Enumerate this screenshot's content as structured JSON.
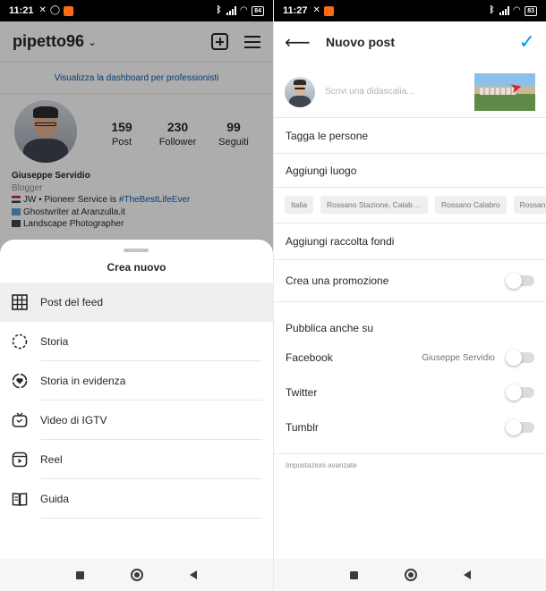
{
  "left": {
    "status": {
      "time": "11:21",
      "battery": "84"
    },
    "profile": {
      "username": "pipetto96",
      "dashboard_link": "Visualizza la dashboard per professionisti",
      "stats": [
        {
          "value": "159",
          "label": "Post"
        },
        {
          "value": "230",
          "label": "Follower"
        },
        {
          "value": "99",
          "label": "Seguiti"
        }
      ],
      "bio": {
        "name": "Giuseppe Servidio",
        "category": "Blogger",
        "line1_text": "JW • Pioneer Service is ",
        "line1_hashtag": "#TheBestLifeEver",
        "line2": "Ghostwriter at Aranzulla.it",
        "line3": "Landscape Photographer"
      }
    },
    "sheet": {
      "title": "Crea nuovo",
      "items": [
        {
          "label": "Post del feed",
          "icon": "grid-icon"
        },
        {
          "label": "Storia",
          "icon": "story-icon"
        },
        {
          "label": "Storia in evidenza",
          "icon": "highlight-heart-icon"
        },
        {
          "label": "Video di IGTV",
          "icon": "igtv-icon"
        },
        {
          "label": "Reel",
          "icon": "reel-icon"
        },
        {
          "label": "Guida",
          "icon": "guide-book-icon"
        }
      ]
    }
  },
  "right": {
    "status": {
      "time": "11:27",
      "battery": "83"
    },
    "header": {
      "title": "Nuovo post"
    },
    "compose": {
      "caption_placeholder": "Scrivi una didascalia..."
    },
    "rows": {
      "tag_people": "Tagga le persone",
      "add_location": "Aggiungi luogo",
      "fundraiser": "Aggiungi raccolta fondi",
      "promotion": "Crea una promozione",
      "publish_also": "Pubblica anche su",
      "advanced": "Impostazioni avanzate"
    },
    "location_chips": [
      "Italia",
      "Rossano Stazione, Calabria,...",
      "Rossano Calabro",
      "Rossano (I"
    ],
    "share_targets": [
      {
        "label": "Facebook",
        "account": "Giuseppe Servidio",
        "enabled": false
      },
      {
        "label": "Twitter",
        "enabled": false
      },
      {
        "label": "Tumblr",
        "enabled": false
      }
    ],
    "promotion_enabled": false
  },
  "colors": {
    "accent_blue": "#0095f6",
    "link_blue": "#0b5cad"
  }
}
